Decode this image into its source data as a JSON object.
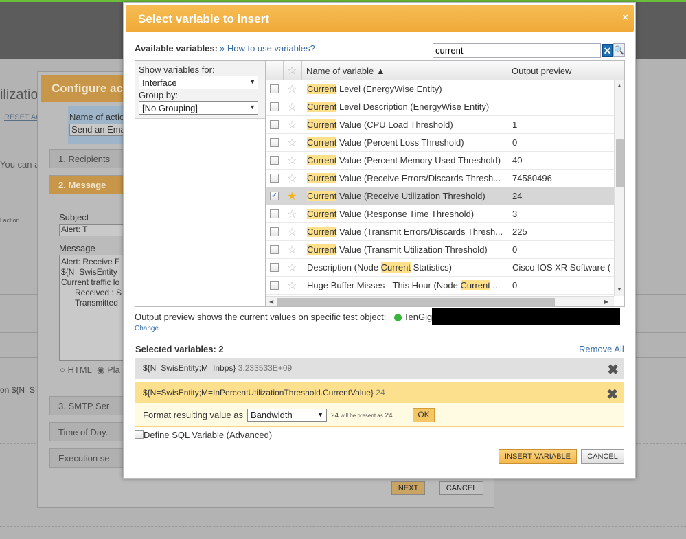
{
  "background": {
    "page_title": "ilization",
    "reset_all": "RESET AC",
    "you_can": "You can a",
    "action_note": "l action.",
    "on_text": "on ${N=S",
    "config_header": "Configure act",
    "name_label": "Name of actio",
    "name_value": "Send an Ema",
    "sections": [
      "1. Recipients",
      "2. Message",
      "3. SMTP Ser",
      "Time of Day.",
      "Execution se"
    ],
    "subject_label": "Subject",
    "subject_value": "Alert: T",
    "message_label": "Message",
    "message_lines": [
      "Alert: Receive F",
      "${N=SwisEntity",
      "Current traffic lo",
      "Received : S",
      "Transmitted"
    ],
    "format_html": "HTML",
    "format_plain": "Pla",
    "next": "NEXT",
    "cancel": "CANCEL"
  },
  "dialog": {
    "title": "Select variable to insert",
    "close": "×",
    "available_label": "Available variables:",
    "how_to": "» How to use variables?",
    "search_value": "current",
    "show_for_label": "Show variables for:",
    "show_for_value": "Interface",
    "group_by_label": "Group by:",
    "group_by_value": "[No Grouping]",
    "col_name": "Name of variable ▲",
    "col_preview": "Output preview",
    "rows": [
      {
        "pre": "",
        "hl": "Current",
        "post": " Level (EnergyWise Entity)",
        "preview": "",
        "checked": "",
        "starred": false
      },
      {
        "pre": "",
        "hl": "Current",
        "post": " Level Description (EnergyWise Entity)",
        "preview": "",
        "checked": "",
        "starred": false
      },
      {
        "pre": "",
        "hl": "Current",
        "post": " Value (CPU Load Threshold)",
        "preview": "1",
        "checked": "",
        "starred": false
      },
      {
        "pre": "",
        "hl": "Current",
        "post": " Value (Percent Loss Threshold)",
        "preview": "0",
        "checked": "",
        "starred": false
      },
      {
        "pre": "",
        "hl": "Current",
        "post": " Value (Percent Memory Used Threshold)",
        "preview": "40",
        "checked": "",
        "starred": false
      },
      {
        "pre": "",
        "hl": "Current",
        "post": " Value (Receive Errors/Discards Thresh...",
        "preview": "74580496",
        "checked": "",
        "starred": false
      },
      {
        "pre": "",
        "hl": "Current",
        "post": " Value (Receive Utilization Threshold)",
        "preview": "24",
        "checked": "✓",
        "starred": true
      },
      {
        "pre": "",
        "hl": "Current",
        "post": " Value (Response Time Threshold)",
        "preview": "3",
        "checked": "",
        "starred": false
      },
      {
        "pre": "",
        "hl": "Current",
        "post": " Value (Transmit Errors/Discards Thresh...",
        "preview": "225",
        "checked": "",
        "starred": false
      },
      {
        "pre": "",
        "hl": "Current",
        "post": " Value (Transmit Utilization Threshold)",
        "preview": "0",
        "checked": "",
        "starred": false
      },
      {
        "pre": "Description (Node ",
        "hl": "Current",
        "post": " Statistics)",
        "preview": "Cisco IOS XR Software (",
        "checked": "",
        "starred": false
      },
      {
        "pre": "Huge Buffer Misses - This Hour (Node ",
        "hl": "Current",
        "post": " ...",
        "preview": "0",
        "checked": "",
        "starred": false
      }
    ],
    "preview_text": "Output preview shows the current values on specific test object:",
    "test_object": "TenGig",
    "change": "Change",
    "selected_label": "Selected variables: 2",
    "remove_all": "Remove All",
    "selected": [
      {
        "expr": "${N=SwisEntity;M=Inbps}",
        "value": "3.233533E+09"
      },
      {
        "expr": "${N=SwisEntity;M=InPercentUtilizationThreshold.CurrentValue}",
        "value": "24"
      }
    ],
    "format_label": "Format resulting value as",
    "format_value": "Bandwidth",
    "format_from": "24",
    "format_middle": "will be present as",
    "format_to": "24",
    "ok": "OK",
    "sql_label": "Define SQL Variable (Advanced)",
    "insert": "INSERT VARIABLE",
    "cancel": "CANCEL"
  }
}
